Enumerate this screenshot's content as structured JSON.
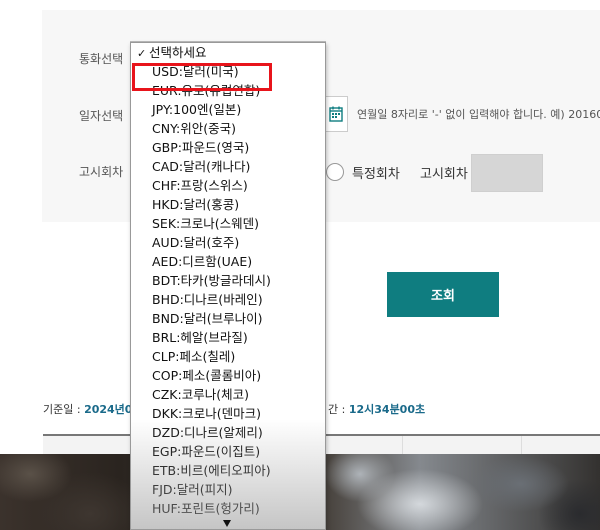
{
  "form": {
    "currency_label": "통화선택",
    "date_label": "일자선택",
    "notice_label": "고시회차",
    "date_hint": "연월일 8자리로 '-' 없이 입력해야 합니다. 예) 20160",
    "specific_round_label": "특정회차",
    "notice_round_label": "고시회차"
  },
  "dropdown": {
    "placeholder": "선택하세요",
    "options": [
      "USD:달러(미국)",
      "EUR:유로(유럽연합)",
      "JPY:100엔(일본)",
      "CNY:위안(중국)",
      "GBP:파운드(영국)",
      "CAD:달러(캐나다)",
      "CHF:프랑(스위스)",
      "HKD:달러(홍콩)",
      "SEK:크로나(스웨덴)",
      "AUD:달러(호주)",
      "AED:디르함(UAE)",
      "BDT:타카(방글라데시)",
      "BHD:디나르(바레인)",
      "BND:달러(브루나이)",
      "BRL:헤알(브라질)",
      "CLP:페소(칠레)",
      "COP:페소(콜롬비아)",
      "CZK:코루나(체코)",
      "DKK:크로나(덴마크)",
      "DZD:디나르(알제리)",
      "EGP:파운드(이집트)",
      "ETB:비르(에티오피아)",
      "FJD:달러(피지)",
      "HUF:포린트(헝가리)"
    ],
    "highlighted": "USD:달러(미국)",
    "highlight_color": "#e8141b"
  },
  "actions": {
    "lookup_label": "조회"
  },
  "info": {
    "base_date_label": "기준일 : ",
    "base_date_value": "2024년0",
    "base_time_label": "간 : ",
    "base_time_value": "12시34분00초"
  },
  "colors": {
    "accent": "#0f7d80",
    "panel_bg": "#f7f7f7"
  }
}
